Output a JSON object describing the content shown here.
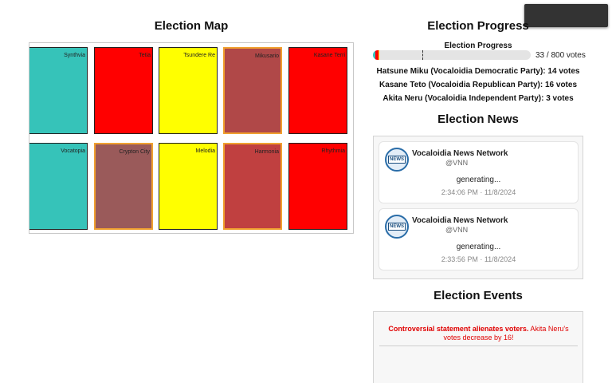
{
  "colors": {
    "teal": "#36c3b9",
    "red": "#ff0000",
    "yellow": "#ffff00",
    "brownish_red": "#b04848",
    "contested_border": "#f0a030",
    "event_text": "#e00000"
  },
  "map": {
    "title": "Election Map",
    "regions": [
      {
        "label": "Synthvia",
        "color": "#36c3b9",
        "contested": false
      },
      {
        "label": "Tetia",
        "color": "#ff0000",
        "contested": false
      },
      {
        "label": "Tsundere Re",
        "color": "#ffff00",
        "contested": false
      },
      {
        "label": "Mikusario",
        "color": "#b04848",
        "contested": true
      },
      {
        "label": "Kasane Terri",
        "color": "#ff0000",
        "contested": false
      },
      {
        "label": "Vocatopia",
        "color": "#36c3b9",
        "contested": false
      },
      {
        "label": "Crypton City",
        "color": "#9a5a5a",
        "contested": true
      },
      {
        "label": "Melodia",
        "color": "#ffff00",
        "contested": false
      },
      {
        "label": "Harmonia",
        "color": "#c04040",
        "contested": true
      },
      {
        "label": "Rhythmia",
        "color": "#ff0000",
        "contested": false
      }
    ]
  },
  "progress": {
    "title": "Election Progress",
    "subtitle": "Election Progress",
    "votes_cast": 33,
    "votes_total": 800,
    "count_text": "33 / 800 votes",
    "marker_fraction": 0.31,
    "segments": [
      {
        "party": "Hatsune Miku",
        "votes": 14,
        "color": "#36c3b9"
      },
      {
        "party": "Kasane Teto",
        "votes": 16,
        "color": "#ff0000"
      },
      {
        "party": "Akita Neru",
        "votes": 3,
        "color": "#ffd700"
      }
    ],
    "parties": [
      "Hatsune Miku (Vocaloidia Democratic Party): 14 votes",
      "Kasane Teto (Vocaloidia Republican Party): 16 votes",
      "Akita Neru (Vocaloidia Independent Party): 3 votes"
    ]
  },
  "news": {
    "title": "Election News",
    "avatar_text": "NEWS",
    "items": [
      {
        "name": "Vocaloidia News Network",
        "handle": "@VNN",
        "body": "generating...",
        "time": "2:34:06 PM · 11/8/2024"
      },
      {
        "name": "Vocaloidia News Network",
        "handle": "@VNN",
        "body": "generating...",
        "time": "2:33:56 PM · 11/8/2024"
      }
    ]
  },
  "events": {
    "title": "Election Events",
    "items": [
      {
        "headline": "Controversial statement alienates voters.",
        "detail": " Akita Neru's votes decrease by 16!"
      }
    ]
  }
}
